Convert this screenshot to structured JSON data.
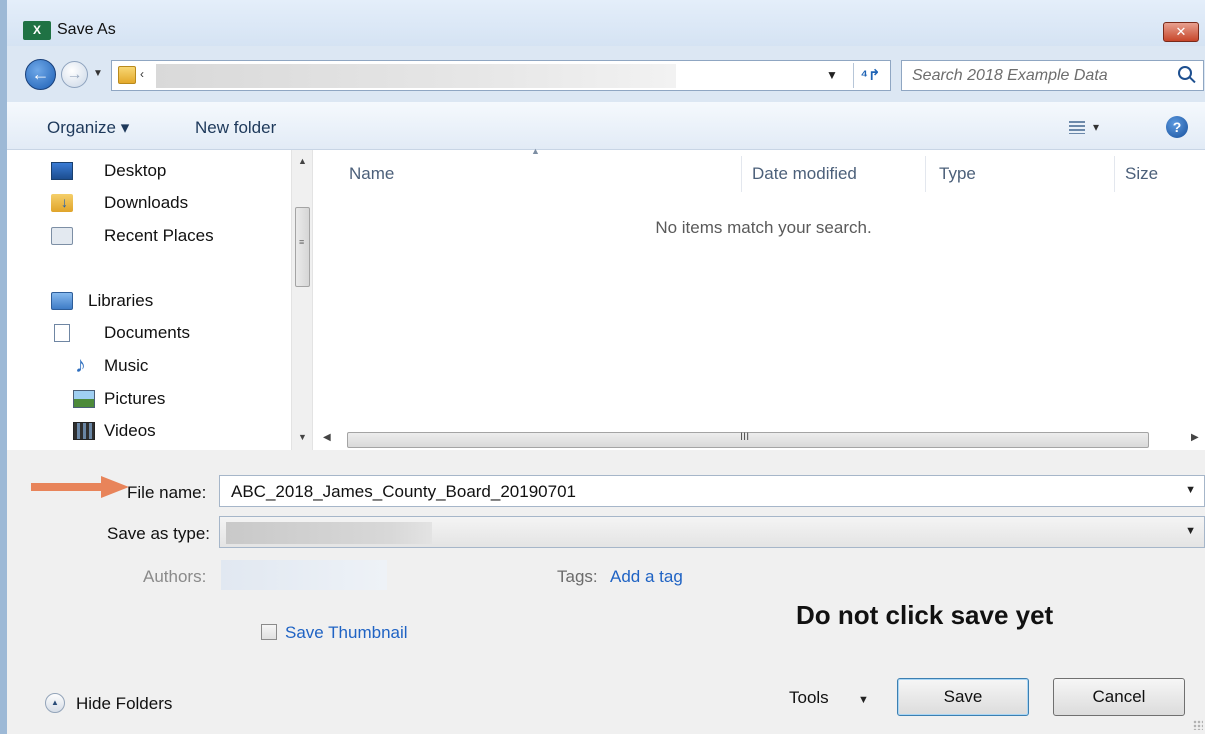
{
  "window": {
    "title": "Save As",
    "app_icon_text": "X",
    "close_label": "✕"
  },
  "navbar": {
    "back_glyph": "←",
    "forward_glyph": "→",
    "dropdown_glyph": "▼",
    "address_chevron": "‹",
    "refresh_glyph": "⁴↱",
    "search_placeholder": "Search 2018 Example Data"
  },
  "toolbar": {
    "organize_label": "Organize ▾",
    "new_folder_label": "New folder",
    "view_dd_glyph": "▾",
    "help_glyph": "?"
  },
  "sidebar": {
    "items": [
      {
        "label": "Desktop",
        "icon": "desktop-icon"
      },
      {
        "label": "Downloads",
        "icon": "downloads-icon"
      },
      {
        "label": "Recent Places",
        "icon": "recent-places-icon"
      },
      {
        "label": "Libraries",
        "icon": "libraries-icon"
      },
      {
        "label": "Documents",
        "icon": "documents-icon"
      },
      {
        "label": "Music",
        "icon": "music-icon"
      },
      {
        "label": "Pictures",
        "icon": "pictures-icon"
      },
      {
        "label": "Videos",
        "icon": "videos-icon"
      }
    ],
    "scroll_up": "▲",
    "scroll_down": "▼",
    "scroll_grip": "≡"
  },
  "filelist": {
    "columns": [
      "Name",
      "Date modified",
      "Type",
      "Size"
    ],
    "sort_glyph": "▲",
    "empty_message": "No items match your search.",
    "hscroll_left": "◀",
    "hscroll_right": "▶",
    "hscroll_grip": "III"
  },
  "form": {
    "filename_label": "File name:",
    "filename_value": "ABC_2018_James_County_Board_20190701",
    "savetype_label": "Save as type:",
    "dropdown_glyph": "▼",
    "authors_label": "Authors:",
    "tags_label": "Tags:",
    "tags_link": "Add a tag",
    "thumbnail_label": "Save Thumbnail",
    "thumbnail_checked": false
  },
  "annotation": {
    "note": "Do not click save yet",
    "arrow_color": "#e8845a"
  },
  "footer": {
    "hide_folders_glyph": "▲",
    "hide_folders_label": "Hide Folders",
    "tools_label": "Tools",
    "tools_dd_glyph": "▼",
    "save_label": "Save",
    "cancel_label": "Cancel"
  }
}
